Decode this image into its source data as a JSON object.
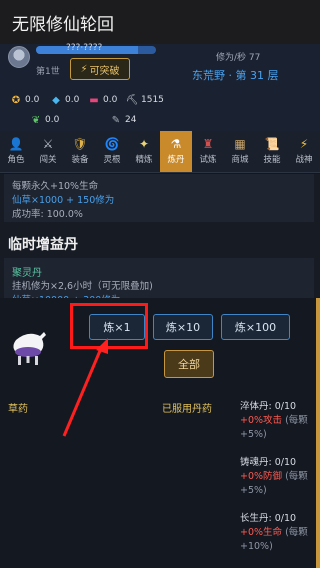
{
  "app": {
    "title": "无限修仙轮回"
  },
  "character": {
    "name_bar_text": "???·????",
    "name_bar_progress": 0.85,
    "generation": "第1世",
    "breakthrough_label": "可突破",
    "rate_text": "修为/秒 77",
    "location": "东荒野 · 第 31 层"
  },
  "resources": [
    {
      "icon": "spirit-swirl-icon",
      "value": "0.0"
    },
    {
      "icon": "gem-icon",
      "value": "0.0"
    },
    {
      "icon": "ticket-icon",
      "value": "0.0"
    },
    {
      "icon": "pickaxe-icon",
      "value": "1515"
    },
    {
      "icon": "herb-icon",
      "value": "0.0"
    },
    {
      "icon": "tool-icon",
      "value": "24"
    }
  ],
  "nav": [
    {
      "id": "character",
      "label": "角色",
      "icon": "person-icon"
    },
    {
      "id": "dungeon",
      "label": "闯关",
      "icon": "swords-icon"
    },
    {
      "id": "equip",
      "label": "装备",
      "icon": "shield-icon"
    },
    {
      "id": "spirit",
      "label": "灵根",
      "icon": "swirl-icon"
    },
    {
      "id": "refine",
      "label": "精炼",
      "icon": "sparkle-icon"
    },
    {
      "id": "alchemy",
      "label": "炼丹",
      "icon": "flask-icon",
      "active": true
    },
    {
      "id": "trial",
      "label": "试炼",
      "icon": "tower-icon"
    },
    {
      "id": "shop",
      "label": "商城",
      "icon": "store-icon"
    },
    {
      "id": "skills",
      "label": "技能",
      "icon": "scroll-icon"
    },
    {
      "id": "warrior",
      "label": "战神",
      "icon": "bolt-icon"
    }
  ],
  "card_top": {
    "desc": "每颗永久+10%生命",
    "cost": "仙草×1000 + 150修为",
    "success": "成功率: 100.0%"
  },
  "section_title": "临时增益丹",
  "card_pill": {
    "name": "聚灵丹",
    "desc": "挂机修为×2,6小时（可无限叠加)",
    "cost": "仙草×10000 + 300修为"
  },
  "dialog": {
    "buttons": [
      "炼×1",
      "炼×10",
      "炼×100"
    ],
    "all_label": "全部",
    "herb_label": "草药",
    "taken_label": "已服用丹药",
    "pills": [
      {
        "name": "淬体丹: 0/10",
        "effect": "+0%攻击",
        "note": "(每颗+5%)"
      },
      {
        "name": "铸魂丹: 0/10",
        "effect": "+0%防御",
        "note": "(每颗+5%)"
      },
      {
        "name": "长生丹: 0/10",
        "effect": "+0%生命",
        "note": "(每颗+10%)"
      }
    ]
  },
  "colors": {
    "accent": "#c98a2b",
    "link": "#4a9fe8",
    "highlight": "#ff1a1a"
  }
}
